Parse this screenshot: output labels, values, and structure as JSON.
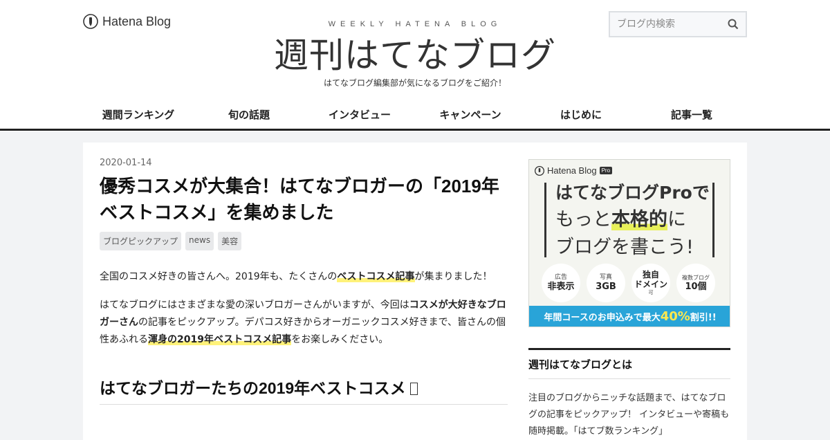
{
  "header": {
    "brand": "Hatena Blog",
    "tagline_top": "WEEKLY HATENA BLOG",
    "title": "週刊はてなブログ",
    "subtitle": "はてなブログ編集部が気になるブログをご紹介！",
    "search_placeholder": "ブログ内検索"
  },
  "nav": {
    "items": [
      "週間ランキング",
      "旬の話題",
      "インタビュー",
      "キャンペーン",
      "はじめに",
      "記事一覧"
    ]
  },
  "post": {
    "date": "2020-01-14",
    "title": "優秀コスメが大集合！はてなブロガーの「2019年ベストコスメ」を集めました",
    "tags": [
      "ブログピックアップ",
      "news",
      "美容"
    ],
    "p1": {
      "a": "全国のコスメ好きの皆さんへ。2019年も、たくさんの",
      "hl": "ベストコスメ記事",
      "b": "が集まりました！"
    },
    "p2": {
      "a": "はてなブログにはさまざまな愛の深いブロガーさんがいますが、今回は",
      "bold": "コスメが大好きなブロガーさん",
      "b": "の記事をピックアップ。デパコス好きからオーガニックコスメ好きまで、皆さんの個性あふれる",
      "hl": "渾身の2019年ベストコスメ記事",
      "c": "をお楽しみください。"
    },
    "h2": "はてなブロガーたちの2019年ベストコスメ"
  },
  "sidebar": {
    "ad": {
      "logo": "Hatena Blog",
      "badge": "Pro",
      "line1": "はてなブログProで",
      "line2_a": "もっと",
      "line2_big": "本格的",
      "line2_b": "に",
      "line3": "ブログを書こう!",
      "features": [
        {
          "small": "広告",
          "big": "非表示",
          "tiny": ""
        },
        {
          "small": "写真",
          "big": "3GB",
          "tiny": ""
        },
        {
          "small": "",
          "big": "独自\nドメイン",
          "tiny": "可"
        },
        {
          "small": "複数ブログ",
          "big": "10個",
          "tiny": ""
        }
      ],
      "banner_a": "年間コースのお申込みで最大",
      "banner_pct": "40%",
      "banner_b": "割引!!"
    },
    "about_title": "週刊はてなブログとは",
    "about_text": "注目のブログからニッチな話題まで、はてなブログの記事をピックアップ！ インタビューや寄稿も随時掲載。「はてブ数ランキング」"
  },
  "colors": {
    "accent_highlight": "#fff27a",
    "pro_banner": "#29a4d8"
  }
}
